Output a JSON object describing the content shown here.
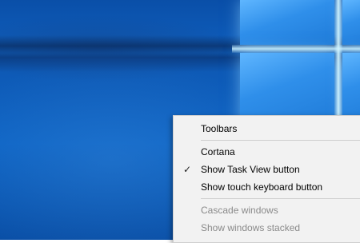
{
  "context_menu": {
    "items": [
      {
        "label": "Toolbars",
        "checked": false,
        "enabled": true
      },
      {
        "label": "Cortana",
        "checked": false,
        "enabled": true
      },
      {
        "label": "Show Task View button",
        "checked": true,
        "enabled": true
      },
      {
        "label": "Show touch keyboard button",
        "checked": false,
        "enabled": true
      },
      {
        "label": "Cascade windows",
        "checked": false,
        "enabled": false
      },
      {
        "label": "Show windows stacked",
        "checked": false,
        "enabled": false
      }
    ],
    "check_glyph": "✓"
  },
  "colors": {
    "wallpaper": "#0d63c4",
    "menu_background": "#f2f2f2",
    "menu_text": "#000000",
    "menu_text_disabled": "#8a8a8a",
    "separator": "#cfcfcf"
  }
}
